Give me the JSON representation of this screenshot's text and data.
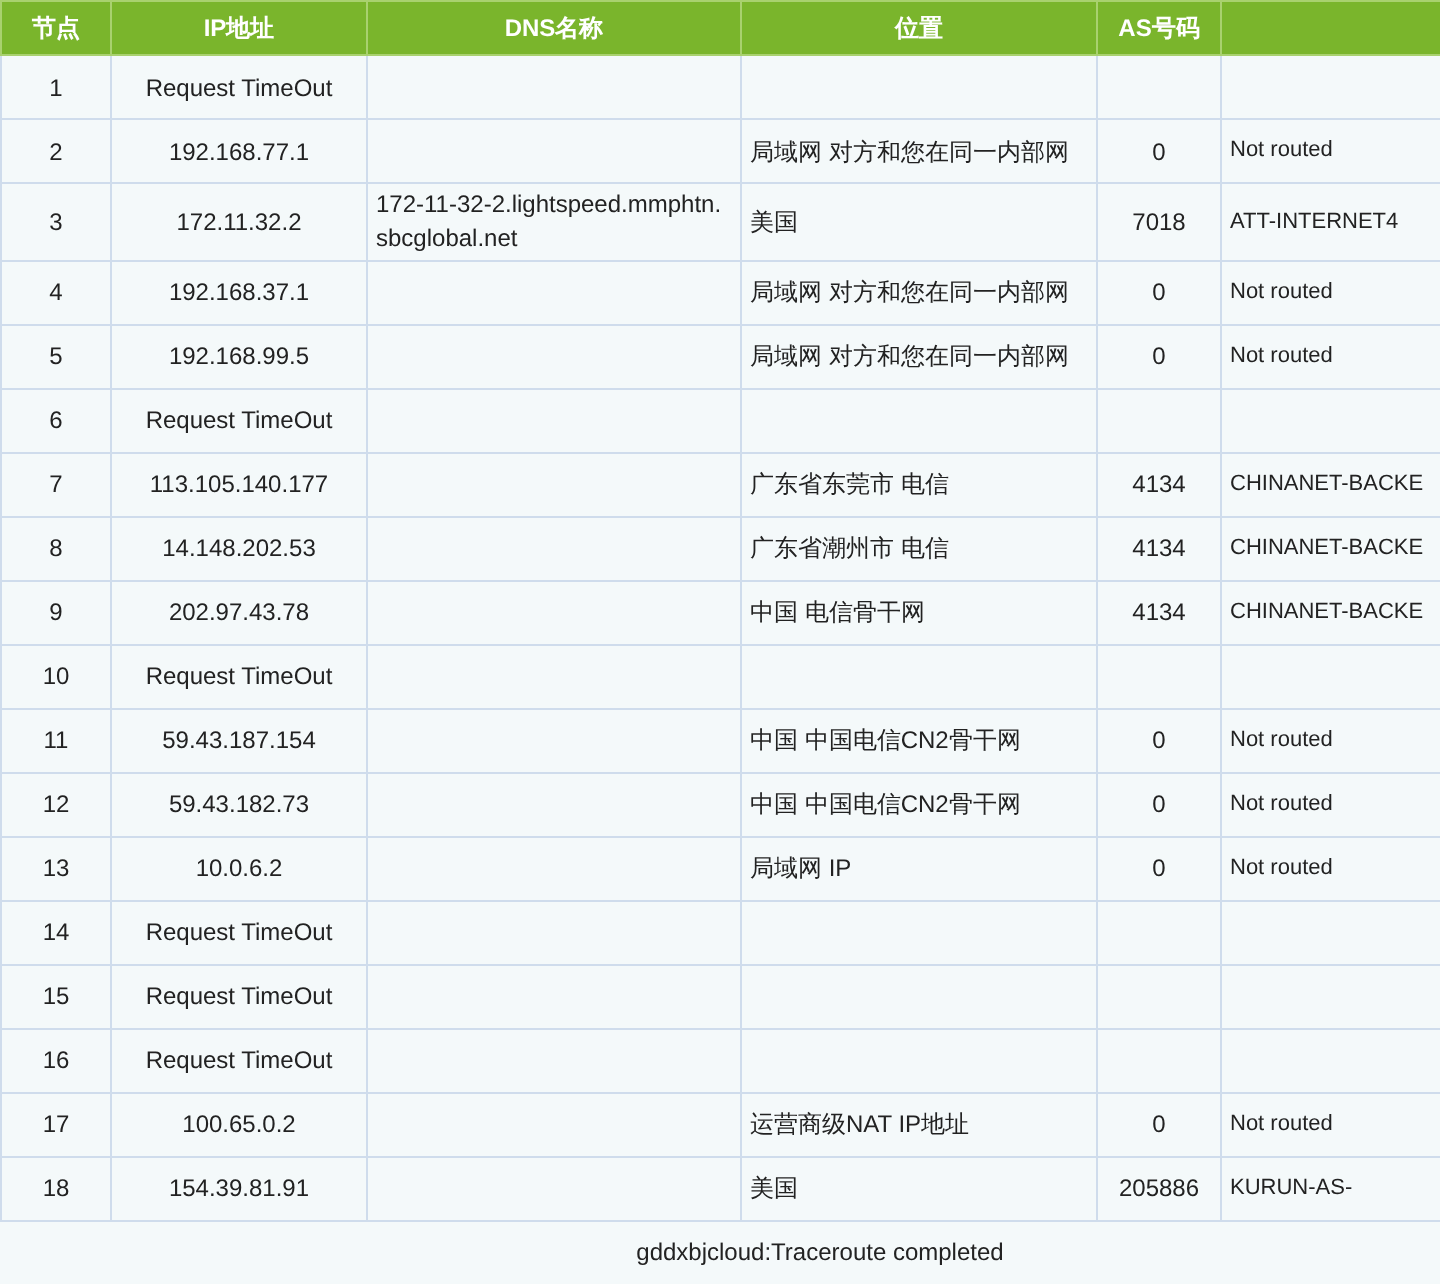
{
  "table": {
    "columns": [
      "节点",
      "IP地址",
      "DNS名称",
      "位置",
      "AS号码"
    ],
    "rows": [
      {
        "hop": "1",
        "ip": "Request TimeOut"
      },
      {
        "hop": "2",
        "ip": "192.168.77.1",
        "location": "局域网 对方和您在同一内部网",
        "as": "0",
        "column_6": "Not routed"
      },
      {
        "hop": "3",
        "ip": "172.11.32.2",
        "dns": "172-11-32-2.lightspeed.mmphtn.sbcglobal.net",
        "location": "美国",
        "as": "7018",
        "column_6": "ATT-INTERNET4"
      },
      {
        "hop": "4",
        "ip": "192.168.37.1",
        "location": "局域网 对方和您在同一内部网",
        "as": "0",
        "column_6": "Not routed"
      },
      {
        "hop": "5",
        "ip": "192.168.99.5",
        "location": "局域网 对方和您在同一内部网",
        "as": "0",
        "column_6": "Not routed"
      },
      {
        "hop": "6",
        "ip": "Request TimeOut"
      },
      {
        "hop": "7",
        "ip": "113.105.140.177",
        "location": "广东省东莞市 电信",
        "as": "4134",
        "column_6": "CHINANET-BACKE"
      },
      {
        "hop": "8",
        "ip": "14.148.202.53",
        "location": "广东省潮州市 电信",
        "as": "4134",
        "column_6": "CHINANET-BACKE"
      },
      {
        "hop": "9",
        "ip": "202.97.43.78",
        "location": "中国 电信骨干网",
        "as": "4134",
        "column_6": "CHINANET-BACKE"
      },
      {
        "hop": "10",
        "ip": "Request TimeOut"
      },
      {
        "hop": "11",
        "ip": "59.43.187.154",
        "location": "中国 中国电信CN2骨干网",
        "as": "0",
        "column_6": "Not routed"
      },
      {
        "hop": "12",
        "ip": "59.43.182.73",
        "location": "中国 中国电信CN2骨干网",
        "as": "0",
        "column_6": "Not routed"
      },
      {
        "hop": "13",
        "ip": "10.0.6.2",
        "location": "局域网 IP",
        "as": "0",
        "column_6": "Not routed"
      },
      {
        "hop": "14",
        "ip": "Request TimeOut"
      },
      {
        "hop": "15",
        "ip": "Request TimeOut"
      },
      {
        "hop": "16",
        "ip": "Request TimeOut"
      },
      {
        "hop": "17",
        "ip": "100.65.0.2",
        "location": "运营商级NAT IP地址",
        "as": "0",
        "column_6": "Not routed"
      },
      {
        "hop": "18",
        "ip": "154.39.81.91",
        "location": "美国",
        "as": "205886",
        "column_6": "KURUN-AS-"
      }
    ]
  },
  "status": "gddxbjcloud:Traceroute completed"
}
